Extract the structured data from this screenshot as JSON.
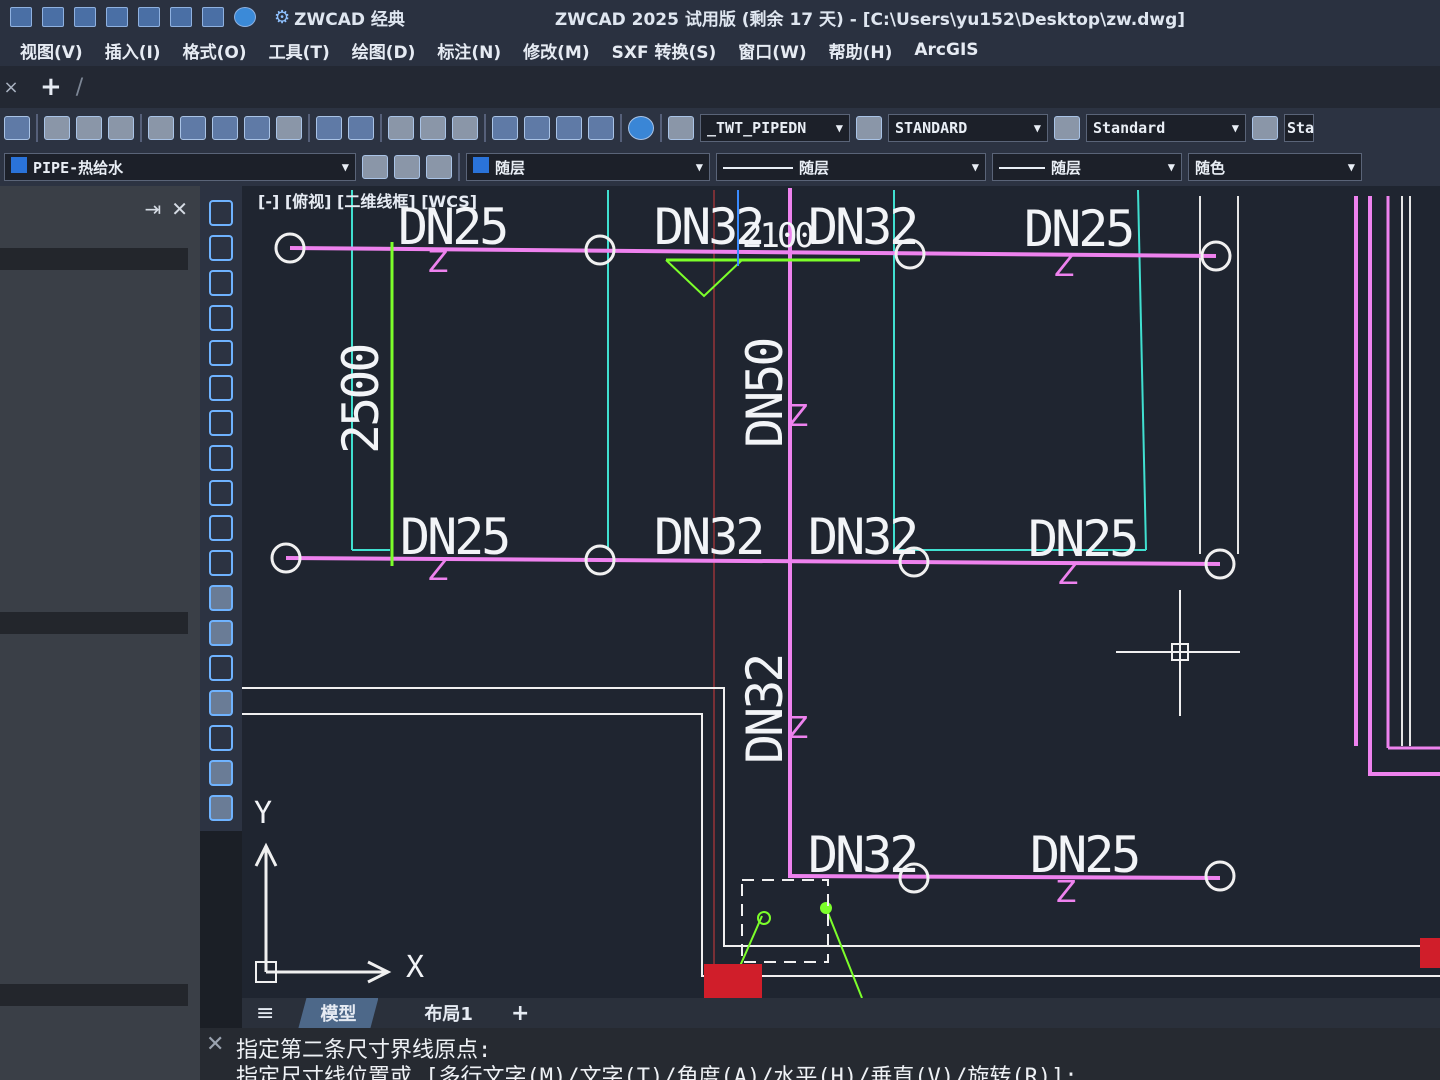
{
  "titlebar": {
    "brand": "ZWCAD 经典",
    "title": "ZWCAD 2025 试用版 (剩余 17 天) - [C:\\Users\\yu152\\Desktop\\zw.dwg]"
  },
  "menu": {
    "items": [
      "视图(V)",
      "插入(I)",
      "格式(O)",
      "工具(T)",
      "绘图(D)",
      "标注(N)",
      "修改(M)",
      "SXF 转换(S)",
      "窗口(W)",
      "帮助(H)",
      "ArcGIS"
    ]
  },
  "toolbar": {
    "text_style": "_TWT_PIPEDN",
    "dim_style": "STANDARD",
    "table_style": "Standard",
    "extra_style": "Sta"
  },
  "layers": {
    "current_layer": "PIPE-热给水",
    "color": "随层",
    "linetype": "随层",
    "lineweight": "随层",
    "plot_style": "随色",
    "layer_color": "#2a73d9"
  },
  "canvas": {
    "view_label": "[-] [俯视] [二维线框] [WCS]",
    "labels": {
      "top_dn25_left": "DN25",
      "top_dn32_left": "DN32",
      "top_overlap": "2100",
      "top_dn32_right": "DN32",
      "top_dn25_right": "DN25",
      "dim_2500": "2500",
      "dn50_vertical": "DN50",
      "mid_dn25_left": "DN25",
      "mid_dn32_left": "DN32",
      "mid_dn32_right": "DN32",
      "mid_dn25_right": "DN25",
      "dn32_vertical": "DN32",
      "bot_dn32": "DN32",
      "bot_dn25": "DN25"
    },
    "axis": {
      "x": "X",
      "y": "Y"
    },
    "colors": {
      "pipe": "#ee82ee",
      "wall": "#40e0d0",
      "dimension": "#7cff2a",
      "background": "#1f2530"
    }
  },
  "layout_tabs": {
    "model": "模型",
    "layout1": "布局1",
    "add": "+"
  },
  "command": {
    "line1": "指定第二条尺寸界线原点:",
    "line2": "指定尺寸线位置或 [多行文字(M)/文字(T)/角度(A)/水平(H)/垂直(V)/旋转(R)]:"
  }
}
